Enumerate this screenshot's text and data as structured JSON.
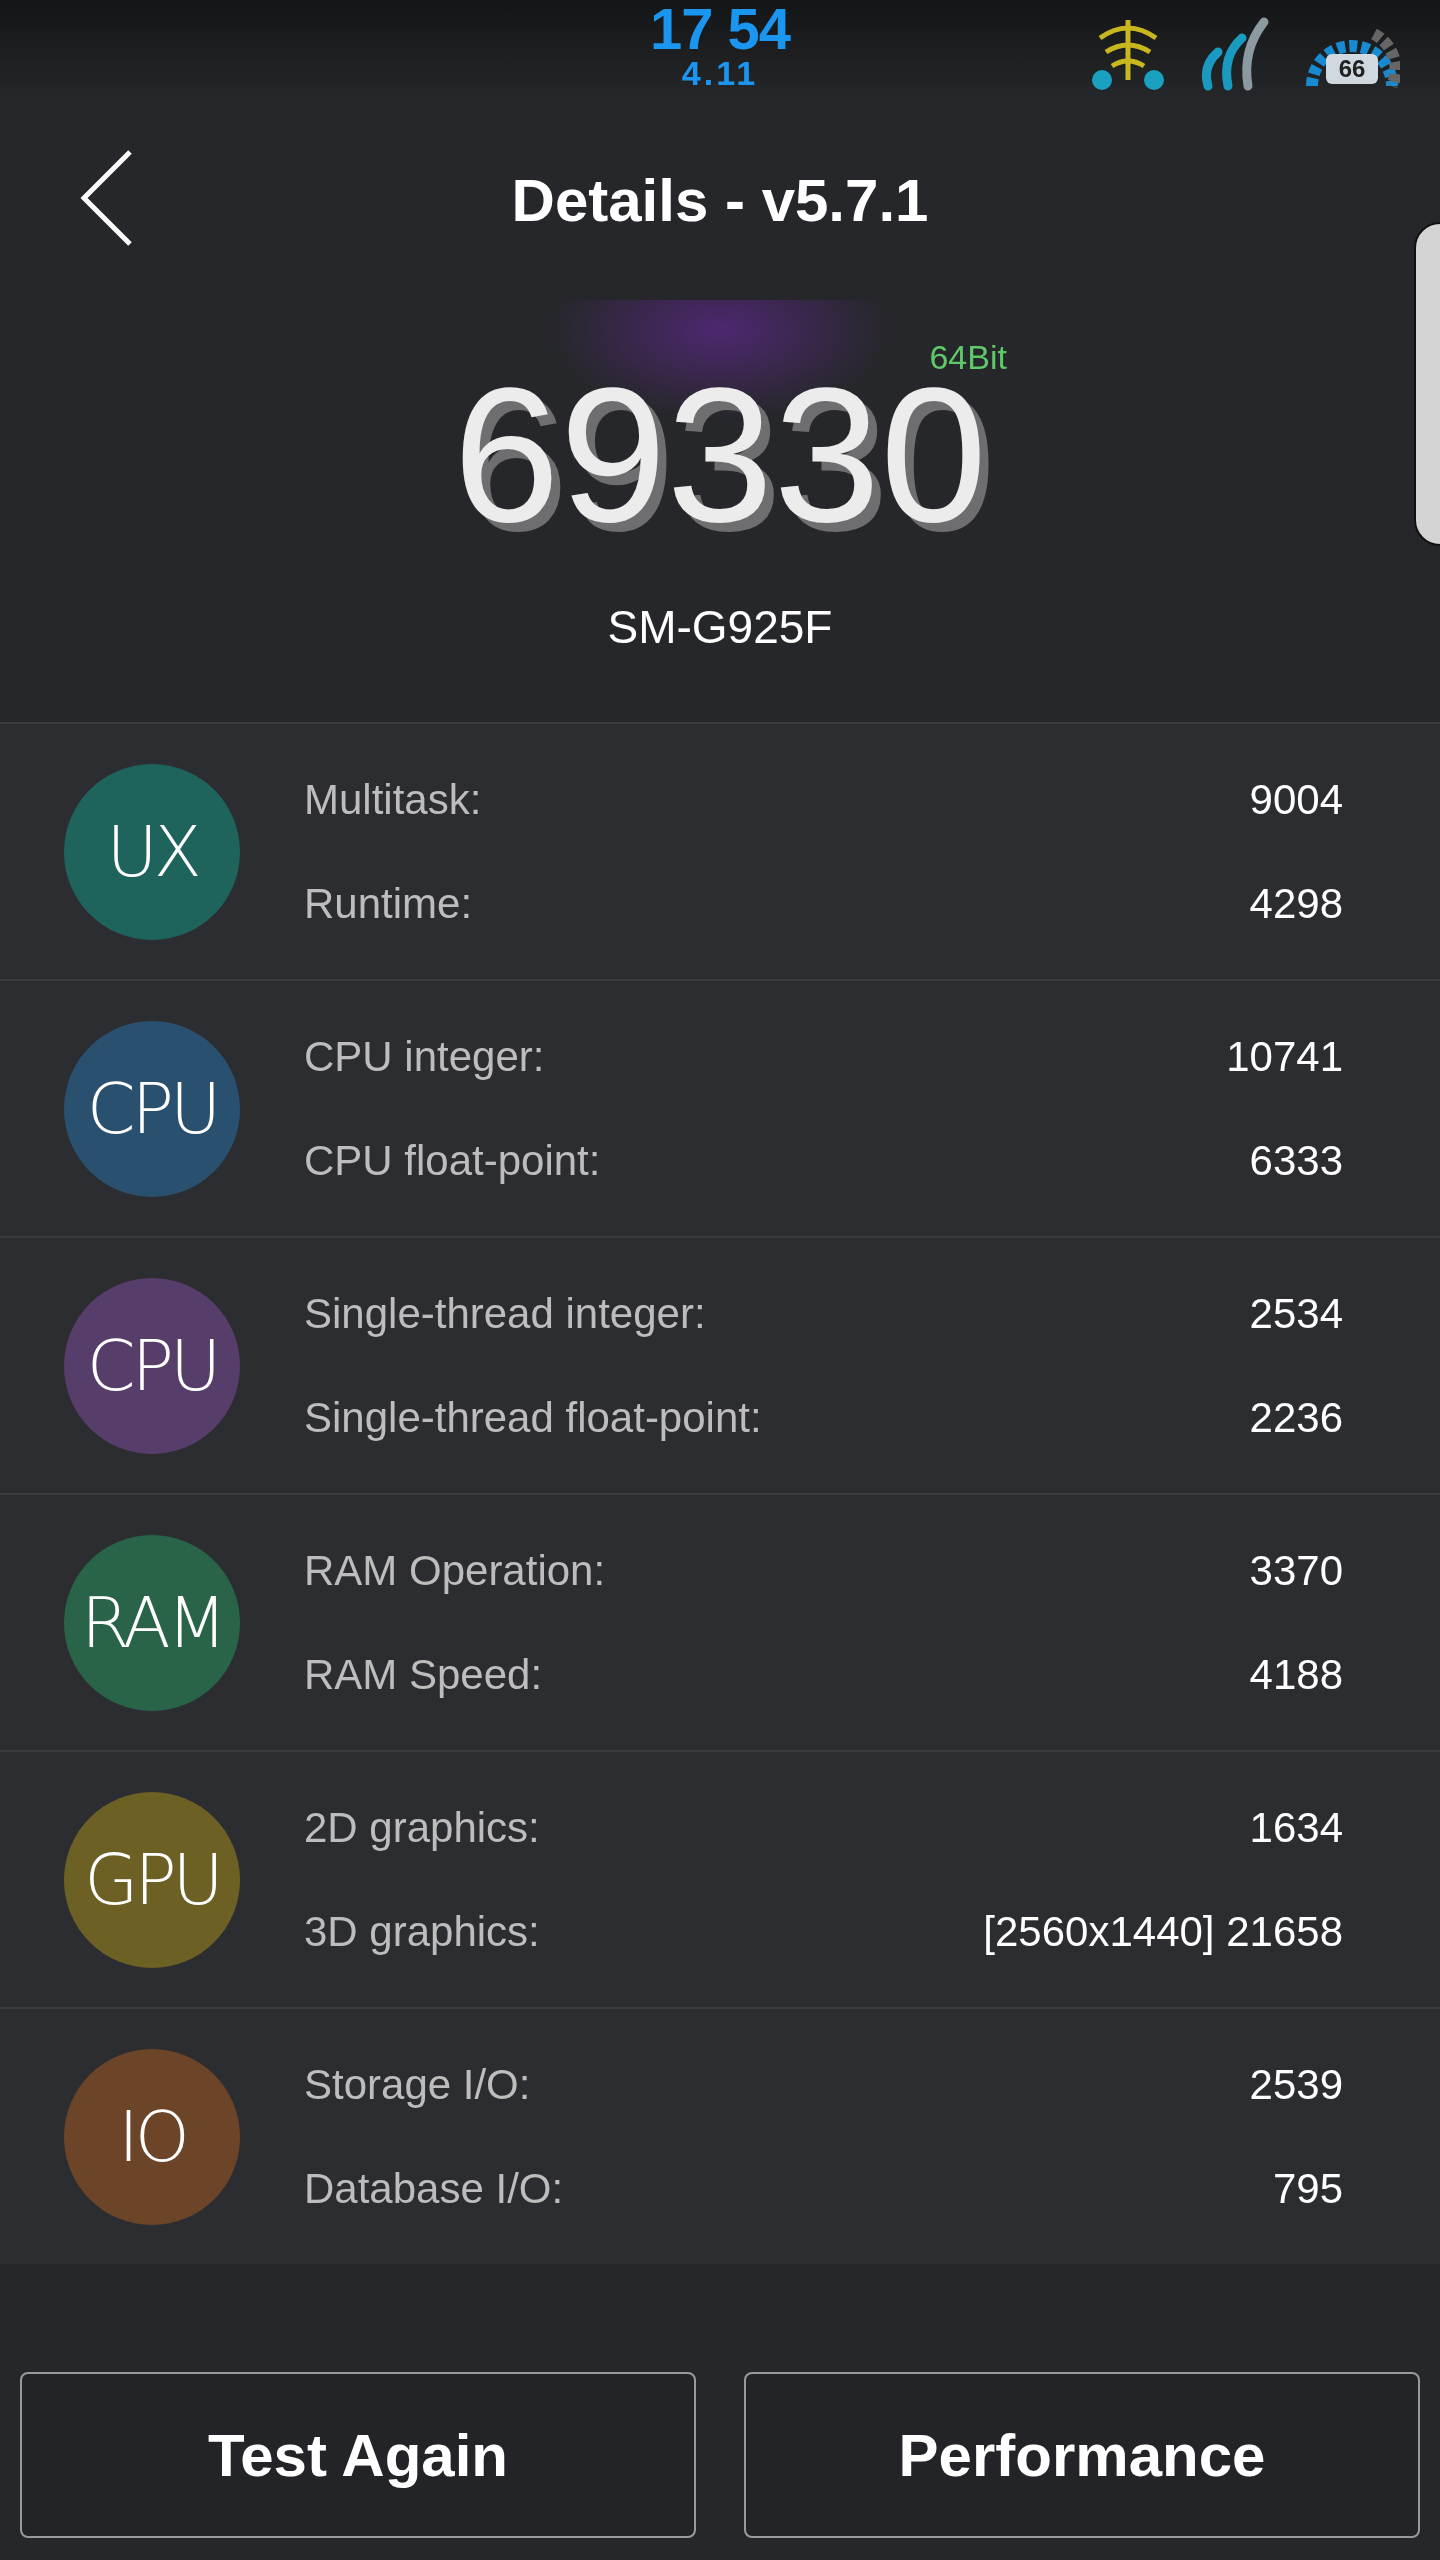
{
  "status_bar": {
    "time": "17 54",
    "date": "4.11",
    "battery": "66"
  },
  "header": {
    "title": "Details - v5.7.1"
  },
  "score": {
    "value": "69330",
    "badge": "64Bit",
    "model": "SM-G925F"
  },
  "categories": [
    {
      "badge": "UX",
      "color": "#1e645c",
      "items": [
        {
          "label": "Multitask:",
          "value": "9004"
        },
        {
          "label": "Runtime:",
          "value": "4298"
        }
      ]
    },
    {
      "badge": "CPU",
      "color": "#2a5070",
      "items": [
        {
          "label": "CPU integer:",
          "value": "10741"
        },
        {
          "label": "CPU float-point:",
          "value": "6333"
        }
      ]
    },
    {
      "badge": "CPU",
      "color": "#573d69",
      "items": [
        {
          "label": "Single-thread integer:",
          "value": "2534"
        },
        {
          "label": "Single-thread float-point:",
          "value": "2236"
        }
      ]
    },
    {
      "badge": "RAM",
      "color": "#2a6448",
      "items": [
        {
          "label": "RAM Operation:",
          "value": "3370"
        },
        {
          "label": "RAM Speed:",
          "value": "4188"
        }
      ]
    },
    {
      "badge": "GPU",
      "color": "#6c6024",
      "items": [
        {
          "label": "2D graphics:",
          "value": "1634"
        },
        {
          "label": "3D graphics:",
          "value": "[2560x1440] 21658"
        }
      ]
    },
    {
      "badge": "IO",
      "color": "#6c4428",
      "items": [
        {
          "label": "Storage I/O:",
          "value": "2539"
        },
        {
          "label": "Database I/O:",
          "value": "795"
        }
      ]
    }
  ],
  "buttons": [
    {
      "label": "Test Again"
    },
    {
      "label": "Performance"
    }
  ]
}
